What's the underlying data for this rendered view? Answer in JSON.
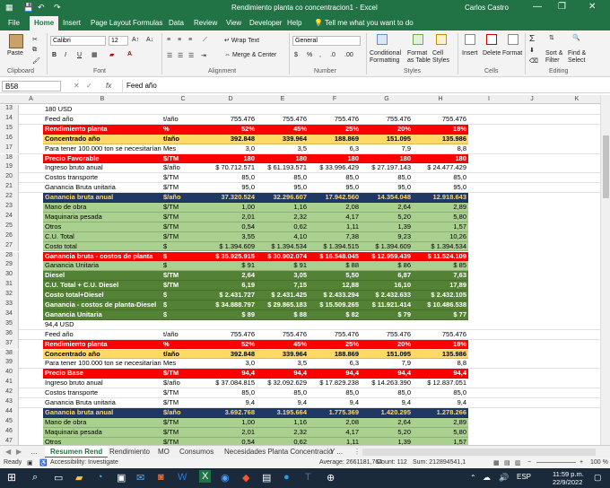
{
  "window": {
    "title": "Rendimiento planta co concentracion1 - Excel",
    "user": "Carlos Castro"
  },
  "ribbon_tabs": [
    "File",
    "Home",
    "Insert",
    "Page Layout",
    "Formulas",
    "Data",
    "Review",
    "View",
    "Developer",
    "Help",
    "Tell me what you want to do"
  ],
  "ribbon": {
    "paste": "Paste",
    "clipboard": "Clipboard",
    "font_name": "Calibri",
    "font_size": "12",
    "font_group": "Font",
    "wrap_text": "Wrap Text",
    "merge_center": "Merge & Center",
    "alignment": "Alignment",
    "number_format": "General",
    "number": "Number",
    "conditional": "Conditional Formatting",
    "format_table": "Format as Table",
    "cell_styles": "Cell Styles",
    "styles": "Styles",
    "insert": "Insert",
    "delete": "Delete",
    "format": "Format",
    "cells": "Cells",
    "sort_filter": "Sort & Filter",
    "find_select": "Find & Select",
    "editing": "Editing",
    "bold": "B",
    "italic": "I",
    "underline": "U"
  },
  "formula_bar": {
    "name_box": "B58",
    "fx": "fx",
    "content": "Feed año"
  },
  "columns": [
    "A",
    "B",
    "C",
    "D",
    "E",
    "F",
    "G",
    "H",
    "I",
    "J",
    "K"
  ],
  "colors": {
    "red": "#ff0000",
    "yellow": "#ffd966",
    "navy": "#1f3864",
    "green": "#a9d08e",
    "darkgreen": "#548235"
  },
  "rows": [
    {
      "n": "13",
      "s": "w",
      "cells": [
        "180 USD",
        "",
        "",
        "",
        "",
        "",
        ""
      ]
    },
    {
      "n": "14",
      "s": "w",
      "cells": [
        "Feed año",
        "t/año",
        "755.476",
        "755.476",
        "755.476",
        "755.476",
        "755.476"
      ]
    },
    {
      "n": "15",
      "s": "red",
      "cells": [
        "Rendimiento planta",
        "%",
        "52%",
        "45%",
        "25%",
        "20%",
        "18%"
      ]
    },
    {
      "n": "16",
      "s": "yel",
      "cells": [
        "Concentrado año",
        "t/año",
        "392.848",
        "339.964",
        "188.869",
        "151.095",
        "135.986"
      ]
    },
    {
      "n": "17",
      "s": "w",
      "cells": [
        "Para tener 100.000 ton se necesitarían",
        "Mes",
        "3,0",
        "3,5",
        "6,3",
        "7,9",
        "8,8"
      ]
    },
    {
      "n": "18",
      "s": "red",
      "cells": [
        "Precio Favorable",
        "$/TM",
        "180",
        "180",
        "180",
        "180",
        "180"
      ]
    },
    {
      "n": "19",
      "s": "w",
      "cells": [
        "Ingreso bruto anual",
        "$/año",
        "$  70.712.571",
        "$  61.193.571",
        "$  33.996.429",
        "$  27.197.143",
        "$  24.477.429"
      ]
    },
    {
      "n": "20",
      "s": "w",
      "cells": [
        "Costos transporte",
        "$/TM",
        "85,0",
        "85,0",
        "85,0",
        "85,0",
        "85,0"
      ]
    },
    {
      "n": "21",
      "s": "w",
      "cells": [
        "Ganancia Bruta unitaria",
        "$/TM",
        "95,0",
        "95,0",
        "95,0",
        "95,0",
        "95,0"
      ]
    },
    {
      "n": "22",
      "s": "navy",
      "cells": [
        "Ganancia bruta anual",
        "$/año",
        "37.320.524",
        "32.296.607",
        "17.942.560",
        "14.354.048",
        "12.918.643"
      ]
    },
    {
      "n": "23",
      "s": "grn",
      "cells": [
        "Mano de obra",
        "$/TM",
        "1,00",
        "1,16",
        "2,08",
        "2,64",
        "2,89"
      ]
    },
    {
      "n": "24",
      "s": "grn",
      "cells": [
        "Maquinaria pesada",
        "$/TM",
        "2,01",
        "2,32",
        "4,17",
        "5,20",
        "5,80"
      ]
    },
    {
      "n": "25",
      "s": "grn",
      "cells": [
        "Otros",
        "$/TM",
        "0,54",
        "0,62",
        "1,11",
        "1,39",
        "1,57"
      ]
    },
    {
      "n": "26",
      "s": "grn",
      "cells": [
        "C.U. Total",
        "$/TM",
        "3,55",
        "4,10",
        "7,38",
        "9,23",
        "10,26"
      ]
    },
    {
      "n": "27",
      "s": "grn",
      "cells": [
        "Costo total",
        "$",
        "$     1.394.609",
        "$     1.394.534",
        "$     1.394.515",
        "$     1.394.609",
        "$     1.394.534"
      ]
    },
    {
      "n": "28",
      "s": "red",
      "cells": [
        "Ganancia bruta - costos de planta",
        "$",
        "$   35.925.915",
        "$   30.902.074",
        "$   16.548.045",
        "$   12.959.439",
        "$   11.524.109"
      ]
    },
    {
      "n": "29",
      "s": "grn",
      "cells": [
        "Ganancia Unitaria",
        "$",
        "$       91",
        "$       91",
        "$       88",
        "$       86",
        "$       85"
      ]
    },
    {
      "n": "30",
      "s": "dgr",
      "cells": [
        "Diesel",
        "$/TM",
        "2,64",
        "3,05",
        "5,50",
        "6,87",
        "7,63"
      ]
    },
    {
      "n": "31",
      "s": "dgr",
      "cells": [
        "C.U. Total + C.U. Diesel",
        "$/TM",
        "6,19",
        "7,15",
        "12,88",
        "16,10",
        "17,89"
      ]
    },
    {
      "n": "32",
      "s": "dgr",
      "cells": [
        "Costo total+Diesel",
        "$",
        "$   2.431.727",
        "$   2.431.425",
        "$   2.433.294",
        "$   2.432.633",
        "$   2.432.105"
      ]
    },
    {
      "n": "33",
      "s": "dgr",
      "cells": [
        "Ganancia - costos de planta-Diesel",
        "$",
        "$   34.888.797",
        "$   29.865.183",
        "$   15.509.265",
        "$   11.921.414",
        "$   10.486.538"
      ]
    },
    {
      "n": "34",
      "s": "dgr",
      "cells": [
        "Ganancia Unitaria",
        "$",
        "$       89",
        "$       88",
        "$       82",
        "$       79",
        "$       77"
      ]
    },
    {
      "n": "35",
      "s": "w",
      "cells": [
        "94,4 USD",
        "",
        "",
        "",
        "",
        "",
        ""
      ]
    },
    {
      "n": "36",
      "s": "w",
      "cells": [
        "Feed año",
        "t/año",
        "755.476",
        "755.476",
        "755.476",
        "755.476",
        "755.476"
      ]
    },
    {
      "n": "37",
      "s": "red",
      "cells": [
        "Rendimiento planta",
        "%",
        "52%",
        "45%",
        "25%",
        "20%",
        "18%"
      ]
    },
    {
      "n": "38",
      "s": "yel",
      "cells": [
        "Concentrado año",
        "t/año",
        "392.848",
        "339.964",
        "188.869",
        "151.095",
        "135.986"
      ]
    },
    {
      "n": "39",
      "s": "w",
      "cells": [
        "Para tener 100.000 ton se necesitarían",
        "Mes",
        "3,0",
        "3,5",
        "6,3",
        "7,9",
        "8,8"
      ]
    },
    {
      "n": "40",
      "s": "red",
      "cells": [
        "Precio Base",
        "$/TM",
        "94,4",
        "94,4",
        "94,4",
        "94,4",
        "94,4"
      ]
    },
    {
      "n": "41",
      "s": "w",
      "cells": [
        "Ingreso bruto anual",
        "$/año",
        "$  37.084.815",
        "$  32.092.629",
        "$  17.829.238",
        "$  14.263.390",
        "$  12.837.051"
      ]
    },
    {
      "n": "42",
      "s": "w",
      "cells": [
        "Costos transporte",
        "$/TM",
        "85,0",
        "85,0",
        "85,0",
        "85,0",
        "85,0"
      ]
    },
    {
      "n": "43",
      "s": "w",
      "cells": [
        "Ganancia Bruta unitaria",
        "$/TM",
        "9,4",
        "9,4",
        "9,4",
        "9,4",
        "9,4"
      ]
    },
    {
      "n": "44",
      "s": "navy",
      "cells": [
        "Ganancia bruta anual",
        "$/año",
        "3.692.768",
        "3.195.664",
        "1.775.369",
        "1.420.295",
        "1.278.266"
      ]
    },
    {
      "n": "45",
      "s": "grn",
      "cells": [
        "Mano de obra",
        "$/TM",
        "1,00",
        "1,16",
        "2,08",
        "2,64",
        "2,89"
      ]
    },
    {
      "n": "46",
      "s": "grn",
      "cells": [
        "Maquinaria pesada",
        "$/TM",
        "2,01",
        "2,32",
        "4,17",
        "5,20",
        "5,80"
      ]
    },
    {
      "n": "47",
      "s": "grn",
      "cells": [
        "Otros",
        "$/TM",
        "0,54",
        "0,62",
        "1,11",
        "1,39",
        "1,57"
      ]
    }
  ],
  "sheet_tabs": [
    "Resumen Rend",
    "Rendimiento",
    "MO",
    "Consumos",
    "Necesidades Planta Concentracio",
    "Y ..."
  ],
  "status": {
    "ready": "Ready",
    "accessibility": "Accessibility: Investigate",
    "average": "Average: 2661181,764",
    "count": "Count: 112",
    "sum": "Sum: 212894541,1",
    "zoom": "100 %"
  },
  "taskbar": {
    "time": "11:59 p.m.",
    "date": "22/9/2022",
    "search_icon": "search-icon"
  }
}
